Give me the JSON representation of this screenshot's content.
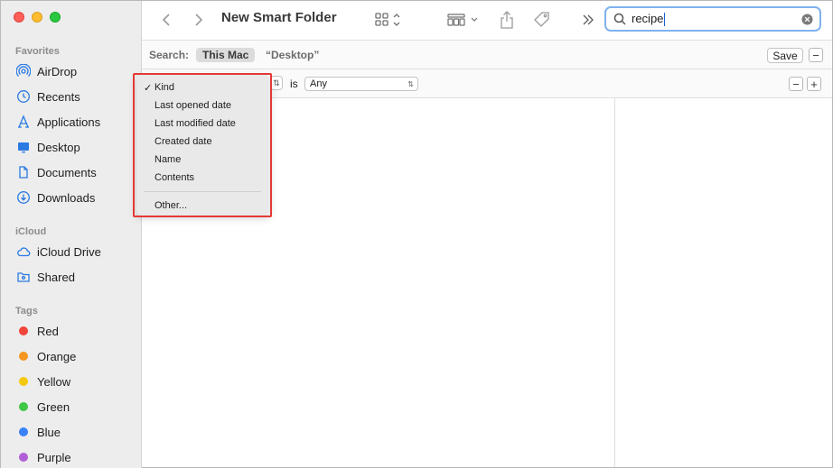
{
  "window": {
    "title": "New Smart Folder"
  },
  "sidebar": {
    "sections": {
      "favorites": "Favorites",
      "icloud": "iCloud",
      "tags": "Tags"
    },
    "favorites": [
      {
        "label": "AirDrop",
        "icon": "airdrop-icon"
      },
      {
        "label": "Recents",
        "icon": "clock-icon"
      },
      {
        "label": "Applications",
        "icon": "applications-icon"
      },
      {
        "label": "Desktop",
        "icon": "desktop-icon"
      },
      {
        "label": "Documents",
        "icon": "document-icon"
      },
      {
        "label": "Downloads",
        "icon": "download-icon"
      }
    ],
    "icloud": [
      {
        "label": "iCloud Drive",
        "icon": "cloud-icon"
      },
      {
        "label": "Shared",
        "icon": "shared-folder-icon"
      }
    ],
    "tags": [
      {
        "label": "Red",
        "color": "#f0443a"
      },
      {
        "label": "Orange",
        "color": "#f5961e"
      },
      {
        "label": "Yellow",
        "color": "#f5c90f"
      },
      {
        "label": "Green",
        "color": "#3ec746"
      },
      {
        "label": "Blue",
        "color": "#3a82f7"
      },
      {
        "label": "Purple",
        "color": "#b05fd6"
      }
    ]
  },
  "search": {
    "query": "recipe"
  },
  "scope": {
    "label": "Search:",
    "this_mac": "This Mac",
    "desktop": "“Desktop”",
    "save_label": "Save",
    "remove_symbol": "−"
  },
  "criteria": {
    "is_label": "is",
    "value": "Any",
    "remove_symbol": "−",
    "add_symbol": "+"
  },
  "attribute_menu": {
    "items": [
      {
        "label": "Kind",
        "checked": "✓"
      },
      {
        "label": "Last opened date"
      },
      {
        "label": "Last modified date"
      },
      {
        "label": "Created date"
      },
      {
        "label": "Name"
      },
      {
        "label": "Contents"
      }
    ],
    "other": "Other..."
  },
  "colors": {
    "highlight": "#e53935",
    "accent": "#1a62d6",
    "sidebar_icon": "#2a7ae2"
  }
}
